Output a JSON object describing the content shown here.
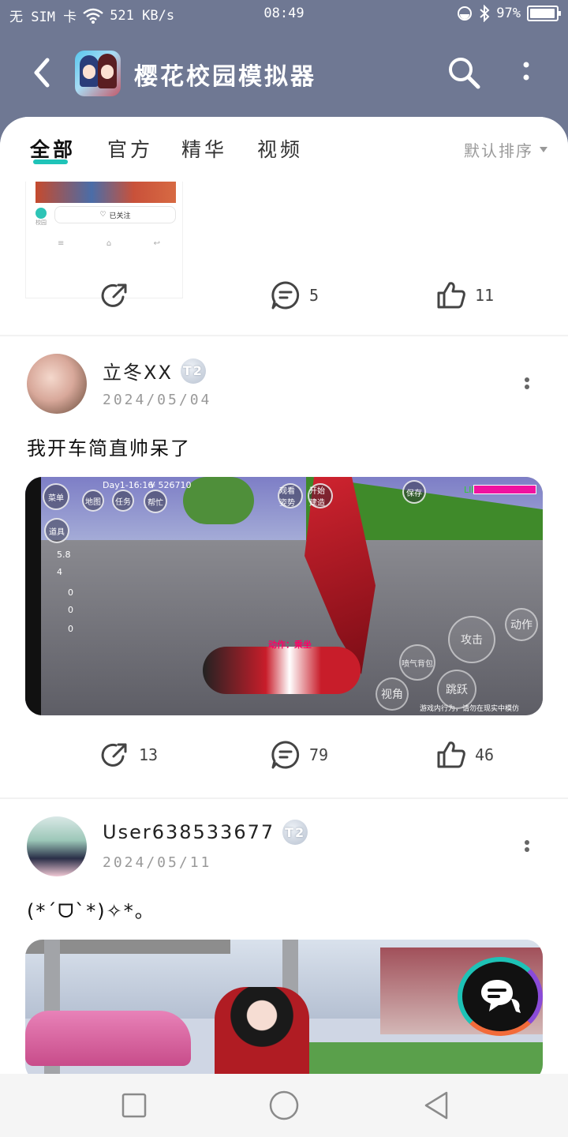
{
  "status_bar": {
    "carrier": "无 SIM 卡",
    "speed": "521 KB/s",
    "time": "08:49",
    "battery": "97%",
    "battery_level": 0.97
  },
  "header": {
    "title": "樱花校园模拟器",
    "back_icon": "back-arrow-icon",
    "search_icon": "search-icon",
    "more_icon": "more-vertical-icon"
  },
  "tabs": [
    {
      "label": "全部",
      "active": true
    },
    {
      "label": "官方",
      "active": false
    },
    {
      "label": "精华",
      "active": false
    },
    {
      "label": "视频",
      "active": false
    }
  ],
  "sort": {
    "label": "默认排序"
  },
  "accent_color": "#1fc3b8",
  "partial_post": {
    "follow_label": "已关注",
    "avatar_label": "校园",
    "actions": {
      "share": "",
      "comment": "5",
      "like": "11"
    }
  },
  "posts": [
    {
      "username": "立冬XX",
      "badge": "T2",
      "date": "2024/05/04",
      "text": "我开车简直帅呆了",
      "image_hud": {
        "day": "Day1-16:16",
        "money": "¥ 526710",
        "menu": "菜单",
        "map": "地图",
        "task": "任务",
        "help": "帮忙",
        "props": "道具",
        "view": "观看 姿势",
        "start": "开始 建造",
        "save": "保存",
        "life": "LIFE",
        "stat1": "5.8",
        "stat2": "4",
        "stat3": "0",
        "stat4": "0",
        "stat5": "0",
        "action": "动作：乘坐",
        "attack": "攻击",
        "action_btn": "动作",
        "spray": "喷气背包",
        "angle": "视角",
        "jump": "跳跃",
        "warning": "游戏内行为，请勿在现实中模仿"
      },
      "actions": {
        "share": "13",
        "comment": "79",
        "like": "46"
      }
    },
    {
      "username": "User638533677",
      "badge": "T2",
      "date": "2024/05/11",
      "text": "(*ˊᗜˋ*)✧*。"
    }
  ],
  "nav": {
    "recent": "square-icon",
    "home": "circle-icon",
    "back": "triangle-back-icon"
  }
}
